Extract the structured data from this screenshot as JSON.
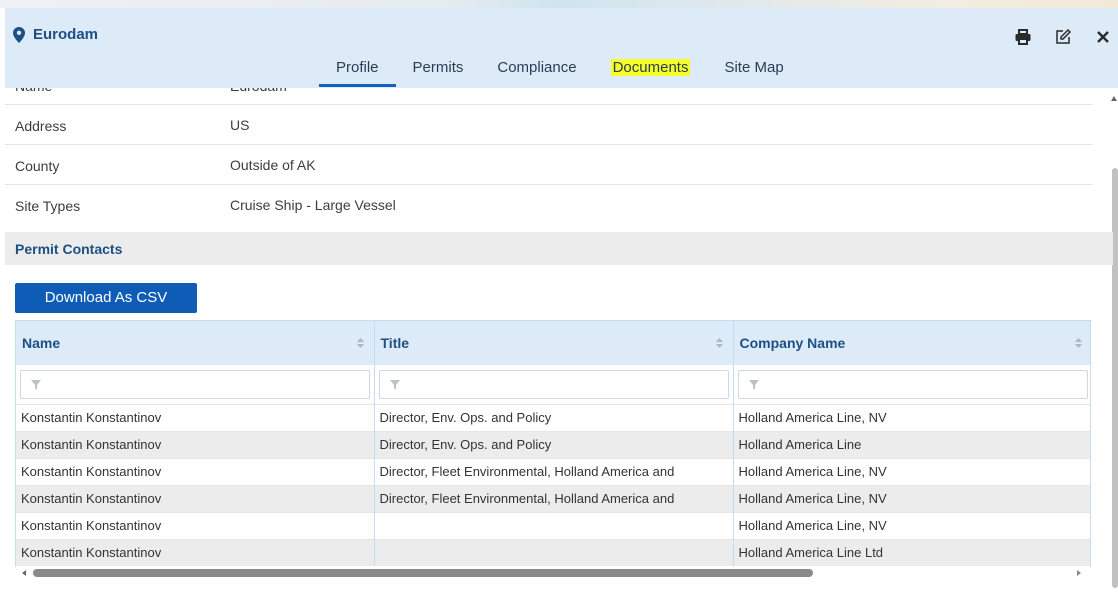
{
  "site": {
    "name": "Eurodam"
  },
  "tabs": [
    {
      "label": "Profile",
      "active": true
    },
    {
      "label": "Permits"
    },
    {
      "label": "Compliance"
    },
    {
      "label": "Documents",
      "highlighted": true
    },
    {
      "label": "Site Map"
    }
  ],
  "header_icons": [
    "print-icon",
    "edit-icon",
    "close-icon"
  ],
  "details": [
    {
      "label": "Name",
      "value": "Eurodam"
    },
    {
      "label": "Address",
      "value": "US"
    },
    {
      "label": "County",
      "value": "Outside of AK"
    },
    {
      "label": "Site Types",
      "value": "Cruise Ship - Large Vessel"
    }
  ],
  "section_title": "Permit Contacts",
  "download_label": "Download As CSV",
  "table": {
    "columns": [
      "Name",
      "Title",
      "Company Name"
    ],
    "rows": [
      [
        "Konstantin Konstantinov",
        "Director, Env. Ops. and Policy",
        "Holland America Line, NV"
      ],
      [
        "Konstantin Konstantinov",
        "Director, Env. Ops. and Policy",
        "Holland America Line"
      ],
      [
        "Konstantin Konstantinov",
        "Director, Fleet Environmental, Holland America and",
        "Holland America Line, NV"
      ],
      [
        "Konstantin Konstantinov",
        "Director, Fleet Environmental, Holland America and",
        "Holland America Line, NV"
      ],
      [
        "Konstantin Konstantinov",
        "",
        "Holland America Line, NV"
      ],
      [
        "Konstantin Konstantinov",
        "",
        "Holland America Line Ltd"
      ]
    ]
  },
  "colors": {
    "accent": "#0f5cb7",
    "header_bg": "#ddebf8",
    "title": "#1d4f84",
    "highlight": "#f7ff28"
  }
}
